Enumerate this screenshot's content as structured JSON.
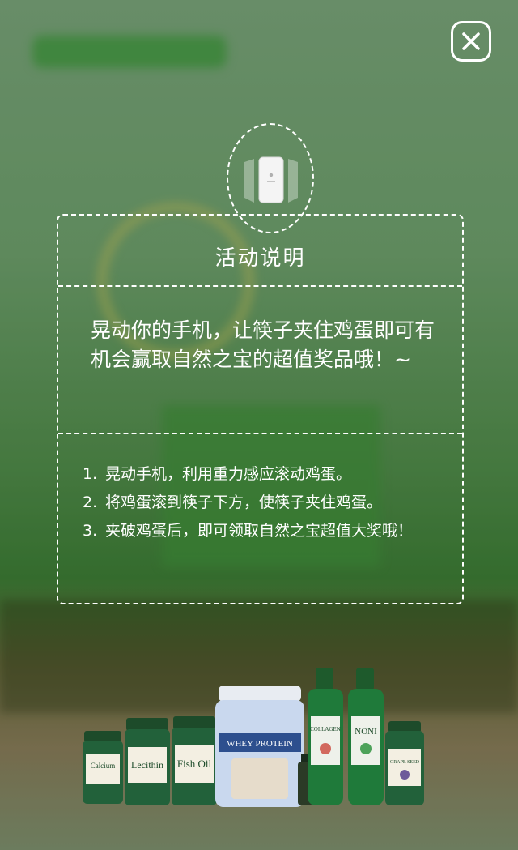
{
  "close_button": {
    "icon": "close-icon"
  },
  "phone_icon": {
    "icon": "shake-phone-icon"
  },
  "panel": {
    "title": "活动说明",
    "intro": "晃动你的手机，让筷子夹住鸡蛋即可有机会赢取自然之宝的超值奖品哦！~",
    "steps": [
      {
        "num": "1.",
        "text": "晃动手机，利用重力感应滚动鸡蛋。"
      },
      {
        "num": "2.",
        "text": "将鸡蛋滚到筷子下方，使筷子夹住鸡蛋。"
      },
      {
        "num": "3.",
        "text": "夹破鸡蛋后，即可领取自然之宝超值大奖哦！"
      }
    ]
  },
  "products": {
    "labels": [
      "Calcium",
      "Lecithin",
      "Fish Oil",
      "WHEY PROTEIN",
      "COLLAGEN",
      "NONI",
      "GRAPE SEED"
    ]
  },
  "colors": {
    "dashed_border": "#ffffff",
    "text": "#ffffff",
    "background_green": "#6e9f6c"
  }
}
